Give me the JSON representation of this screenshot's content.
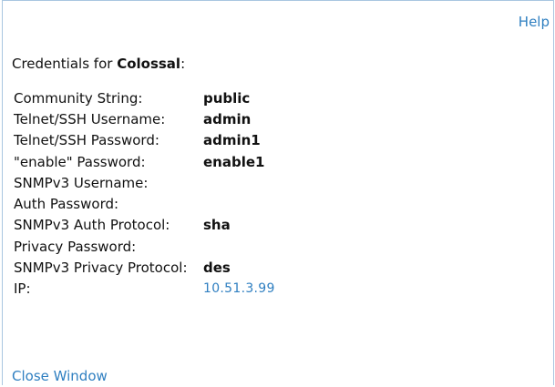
{
  "header": {
    "help_label": "Help"
  },
  "title": {
    "prefix": "Credentials for ",
    "host": "Colossal",
    "suffix": ":"
  },
  "credentials": [
    {
      "label": "Community String:",
      "value": "public"
    },
    {
      "label": "Telnet/SSH Username:",
      "value": "admin"
    },
    {
      "label": "Telnet/SSH Password:",
      "value": "admin1"
    },
    {
      "label": "\"enable\" Password:",
      "value": "enable1"
    },
    {
      "label": "SNMPv3 Username:",
      "value": ""
    },
    {
      "label": "Auth Password:",
      "value": ""
    },
    {
      "label": "SNMPv3 Auth Protocol:",
      "value": "sha"
    },
    {
      "label": "Privacy Password:",
      "value": ""
    },
    {
      "label": "SNMPv3 Privacy Protocol:",
      "value": "des"
    },
    {
      "label": "IP:",
      "value": "10.51.3.99"
    }
  ],
  "footer": {
    "close_label": "Close Window"
  },
  "colors": {
    "link": "#2f7fc1",
    "border": "#a9c6e0"
  }
}
